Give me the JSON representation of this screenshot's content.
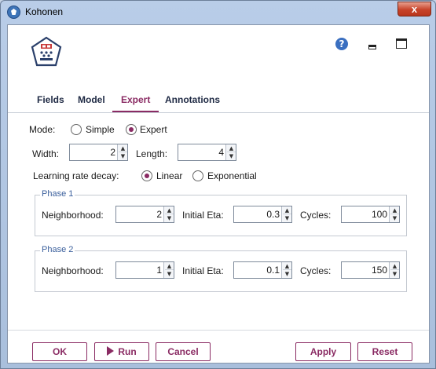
{
  "window": {
    "title": "Kohonen",
    "close_label": "x",
    "help_label": "?"
  },
  "tabs": [
    "Fields",
    "Model",
    "Expert",
    "Annotations"
  ],
  "active_tab": "Expert",
  "expert": {
    "mode_label": "Mode:",
    "mode_simple": "Simple",
    "mode_expert": "Expert",
    "mode_selected": "Expert",
    "width_label": "Width:",
    "width_value": "2",
    "length_label": "Length:",
    "length_value": "4",
    "decay_label": "Learning rate decay:",
    "decay_linear": "Linear",
    "decay_exponential": "Exponential",
    "decay_selected": "Linear",
    "phase1": {
      "title": "Phase 1",
      "neighborhood_label": "Neighborhood:",
      "neighborhood_value": "2",
      "eta_label": "Initial Eta:",
      "eta_value": "0.3",
      "cycles_label": "Cycles:",
      "cycles_value": "100"
    },
    "phase2": {
      "title": "Phase 2",
      "neighborhood_label": "Neighborhood:",
      "neighborhood_value": "1",
      "eta_label": "Initial Eta:",
      "eta_value": "0.1",
      "cycles_label": "Cycles:",
      "cycles_value": "150"
    }
  },
  "buttons": {
    "ok": "OK",
    "run": "Run",
    "cancel": "Cancel",
    "apply": "Apply",
    "reset": "Reset"
  },
  "colors": {
    "accent": "#8a2b63",
    "close": "#c7432a",
    "help": "#3a6fc0",
    "group_title": "#3a5f9c"
  }
}
